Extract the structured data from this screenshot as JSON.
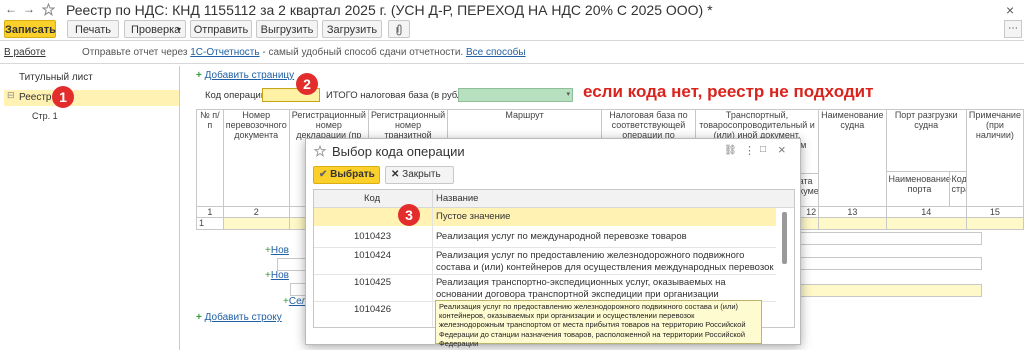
{
  "window": {
    "title": "Реестр по НДС: КНД 1155112 за 2 квартал 2025 г. (УСН Д-Р, ПЕРЕХОД НА НДС 20% С 2025 ООО) *"
  },
  "toolbar": {
    "save": "Записать",
    "print": "Печать",
    "check": "Проверка",
    "send": "Отправить",
    "upload": "Выгрузить",
    "load": "Загрузить"
  },
  "status": {
    "in_work": "В работе",
    "info_prefix": "Отправьте отчет через",
    "info_link": "1С-Отчетность",
    "info_mid": "- самый удобный способ сдачи отчетности.",
    "info_ways": "Все способы"
  },
  "sidebar": {
    "items": [
      "Титульный лист",
      "Реестр",
      "Стр. 1"
    ]
  },
  "form": {
    "add_page": "Добавить страницу",
    "op_code_label": "Код операции:",
    "total_label": "ИТОГО налоговая база (в рублях):",
    "add_row": "Добавить строку",
    "new_link": "Нов",
    "new_link2": "Нов",
    "sel_link": "Сел"
  },
  "annotations": {
    "n1": "1",
    "n2": "2",
    "n3": "3",
    "red_text": "если кода нет, реестр не подходит"
  },
  "table": {
    "headers": [
      "№ п/п",
      "Номер перевозочного документа",
      "Регистрационный номер декларации (пр",
      "Регистрационный номер транзитной",
      "Маршрут",
      "Налоговая база по соответствующей операции по реализации",
      "Транспортный, товаросопроводительный и (или) иной документ, указанный в четвертым статьи 165 ской",
      "Наименование судна",
      "Порт разгрузки судна",
      "Примечание (при наличии)"
    ],
    "sub_headers": [
      "Дата документа",
      "Наименование порта",
      "Код страны"
    ],
    "num_row": [
      "1",
      "2",
      "12",
      "13",
      "14",
      "15"
    ],
    "first_row": "1"
  },
  "dialog": {
    "title": "Выбор кода операции",
    "select": "Выбрать",
    "close": "Закрыть",
    "col_code": "Код",
    "col_name": "Название",
    "rows": [
      {
        "code": "",
        "name": "Пустое значение"
      },
      {
        "code": "1010423",
        "name": "Реализация услуг по международной перевозке товаров"
      },
      {
        "code": "1010424",
        "name": "Реализация услуг по предоставлению железнодорожного подвижного состава и (или) контейнеров для осуществления международных перевозок"
      },
      {
        "code": "1010425",
        "name": "Реализация транспортно-экспедиционных услуг, оказываемых на основании договора транспортной экспедиции при организации международной перевозки"
      },
      {
        "code": "1010426",
        "name": ""
      }
    ],
    "tooltip": "Реализация услуг по предоставлению железнодорожного подвижного состава и (или) контейнеров, оказываемых при организации и осуществлении перевозок железнодорожным транспортом от места прибытия товаров на территорию Российской Федерации до станции назначения товаров, расположенной на территории Российской Федерации"
  }
}
